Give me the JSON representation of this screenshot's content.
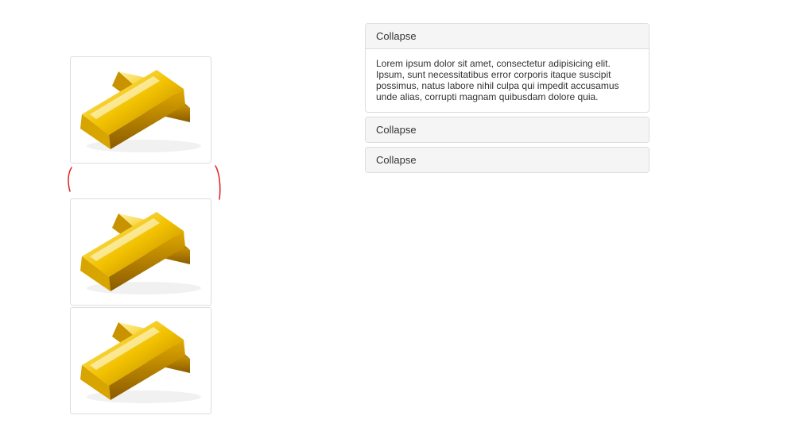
{
  "images": [
    {
      "icon": "gold-bars-image"
    },
    {
      "icon": "gold-bars-image"
    },
    {
      "icon": "gold-bars-image"
    }
  ],
  "annotation": {
    "color": "#e02020"
  },
  "accordion": {
    "panels": [
      {
        "title": "Collapse",
        "body": "Lorem ipsum dolor sit amet, consectetur adipisicing elit. Ipsum, sunt necessitatibus error corporis itaque suscipit possimus, natus labore nihil culpa qui impedit accusamus unde alias, corrupti magnam quibusdam dolore quia.",
        "expanded": true
      },
      {
        "title": "Collapse",
        "expanded": false
      },
      {
        "title": "Collapse",
        "expanded": false
      }
    ]
  }
}
